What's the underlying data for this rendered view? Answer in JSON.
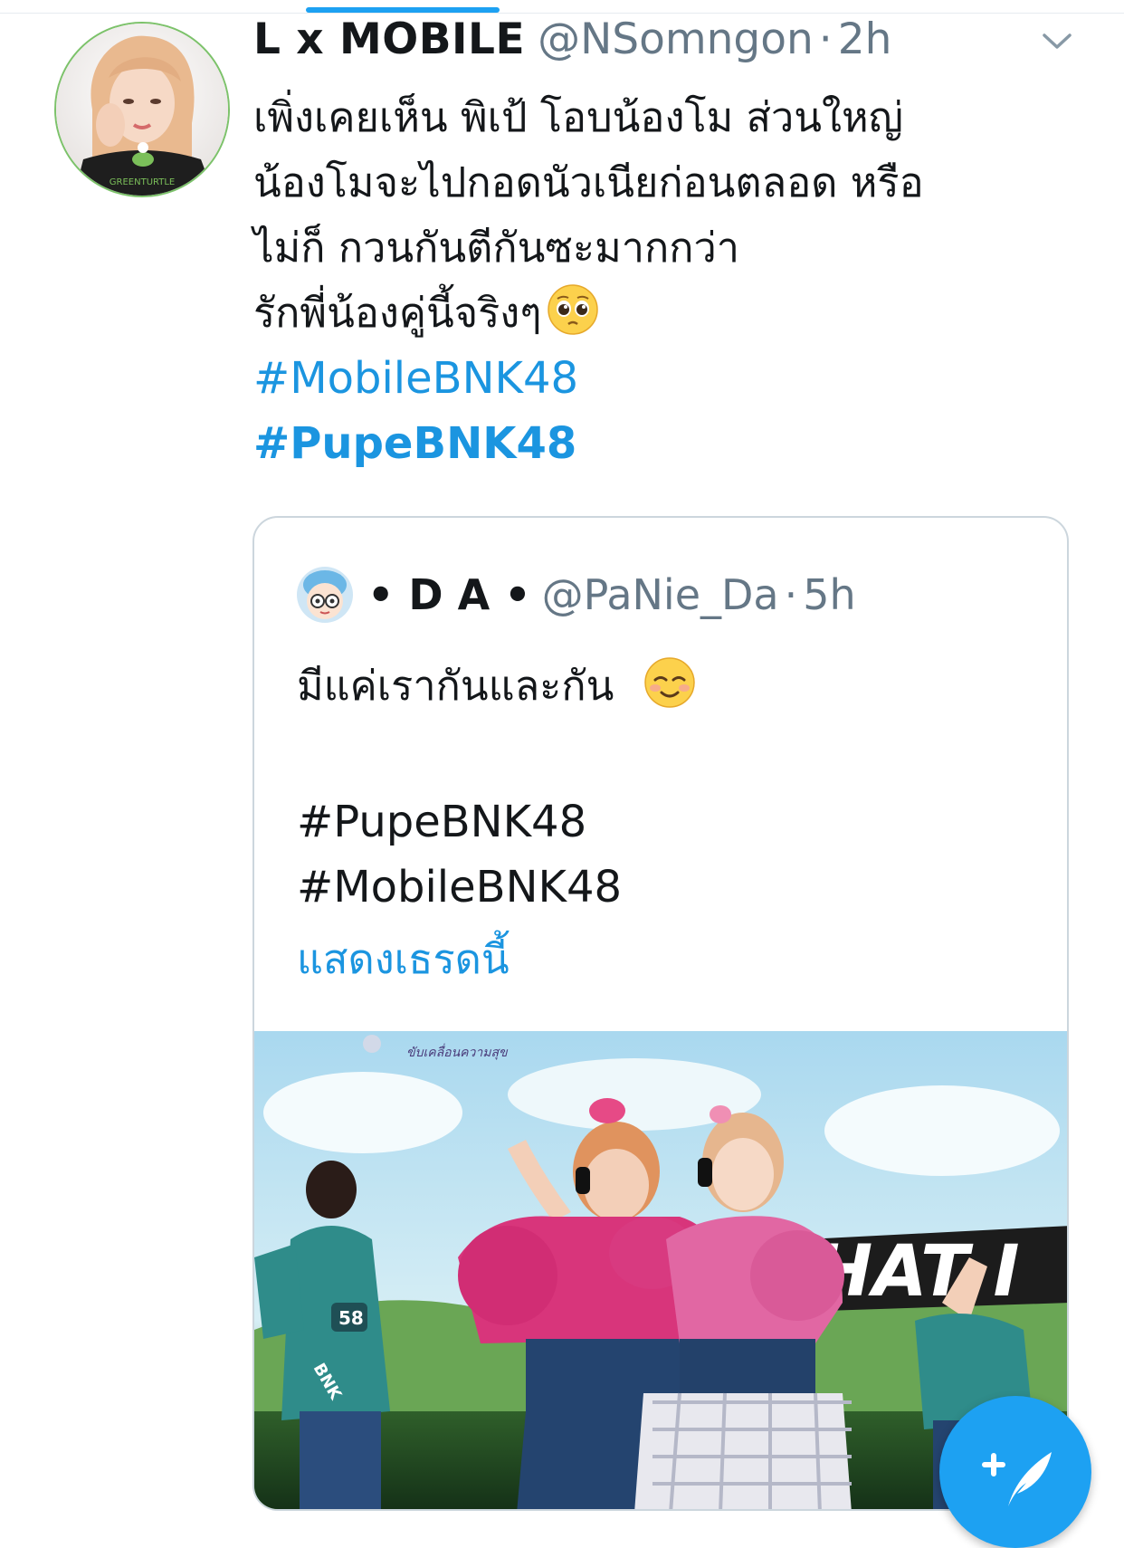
{
  "tweet": {
    "display_name": "L x MOBILE",
    "handle": "@NSomngon",
    "separator": "·",
    "time": "2h",
    "text_lines": [
      "เพิ่งเคยเห็น พิเป้ โอบน้องโม ส่วนใหญ่",
      "น้องโมจะไปกอดนัวเนียก่อนตลอด หรือ",
      "ไม่ก็ กวนกันตีกันซะมากกว่า",
      "รักพี่น้องคู่นี้จริงๆ"
    ],
    "emoji_icon": "pleading-face-icon",
    "hashtags": [
      "#MobileBNK48",
      "#PupeBNK48"
    ],
    "avatar_text": "GREENTURTLE"
  },
  "quoted_tweet": {
    "display_name": "• D A •",
    "handle": "@PaNie_Da",
    "separator": "·",
    "time": "5h",
    "text": "มีแค่เรากันและกัน",
    "emoji_icon": "smiling-face-icon",
    "hashtags": [
      "#PupeBNK48",
      "#MobileBNK48"
    ],
    "show_thread_label": "แสดงเธรดนี้",
    "media": {
      "banner_text": "ขับเคลื่อนความสุข",
      "stage_text": "HAT I",
      "jacket_number": "58",
      "sleeve_text": "BNK"
    }
  },
  "compose_button": {
    "icon": "compose-feather-plus-icon"
  },
  "colors": {
    "link": "#1b95e0",
    "accent": "#1da1f2",
    "secondary_text": "#657786",
    "border": "#ccd6dd"
  }
}
